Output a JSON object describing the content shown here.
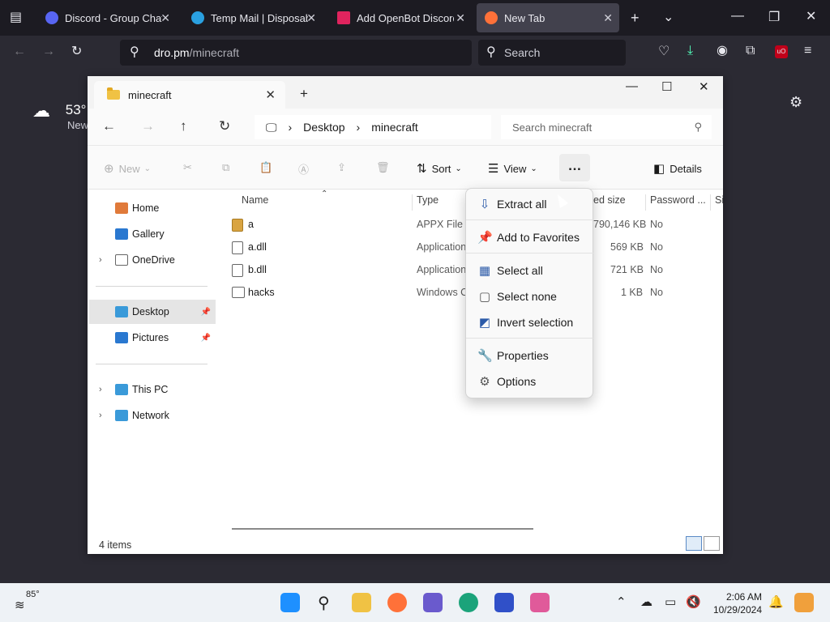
{
  "browser": {
    "tabs": [
      {
        "title": "Discord - Group Chat That's All Fun & Games",
        "color": "#5865f2"
      },
      {
        "title": "Temp Mail | Disposable Email",
        "color": "#2aa0e0"
      },
      {
        "title": "Add OpenBot Discord Bot",
        "color": "#e0245e"
      },
      {
        "title": "New Tab",
        "color": "#ff7139"
      }
    ],
    "url_host": "dro.pm",
    "url_path": "/minecraft",
    "search_placeholder": "Search"
  },
  "newtab": {
    "weather_temp": "53°",
    "weather_sub": "New"
  },
  "explorer": {
    "tab_title": "minecraft",
    "crumbs": [
      "Desktop",
      "minecraft"
    ],
    "search_placeholder": "Search minecraft",
    "commands": {
      "new": "New",
      "sort": "Sort",
      "view": "View",
      "more": "…",
      "details": "Details"
    },
    "nav": [
      {
        "label": "Home",
        "color": "#e07a3a"
      },
      {
        "label": "Gallery",
        "color": "#2a78d0"
      },
      {
        "label": "OneDrive",
        "color": "#ffffff"
      },
      {
        "label": "Desktop",
        "color": "#3a9ad9"
      },
      {
        "label": "Pictures",
        "color": "#2a78d0"
      },
      {
        "label": "This PC",
        "color": "#3a9ad9"
      },
      {
        "label": "Network",
        "color": "#3a9ad9"
      }
    ],
    "columns": {
      "name": "Name",
      "type": "Type",
      "size": "ed size",
      "password": "Password ...",
      "extra": "Si"
    },
    "files": [
      {
        "name": "a",
        "type": "APPX File",
        "size": "790,146 KB",
        "password": "No"
      },
      {
        "name": "a.dll",
        "type": "Application",
        "size": "569 KB",
        "password": "No"
      },
      {
        "name": "b.dll",
        "type": "Application",
        "size": "721 KB",
        "password": "No"
      },
      {
        "name": "hacks",
        "type": "Windows C",
        "size": "1 KB",
        "password": "No"
      }
    ],
    "status": "4 items"
  },
  "menu": {
    "items": [
      {
        "label": "Extract all",
        "icon": "extract-icon"
      },
      {
        "label": "Add to Favorites",
        "icon": "pin-icon"
      },
      {
        "label": "Select all",
        "icon": "select-all-icon"
      },
      {
        "label": "Select none",
        "icon": "select-none-icon"
      },
      {
        "label": "Invert selection",
        "icon": "invert-selection-icon"
      },
      {
        "label": "Properties",
        "icon": "wrench-icon"
      },
      {
        "label": "Options",
        "icon": "gear-icon"
      }
    ]
  },
  "taskbar": {
    "temp": "85°",
    "time": "2:06 AM",
    "date": "10/29/2024"
  }
}
